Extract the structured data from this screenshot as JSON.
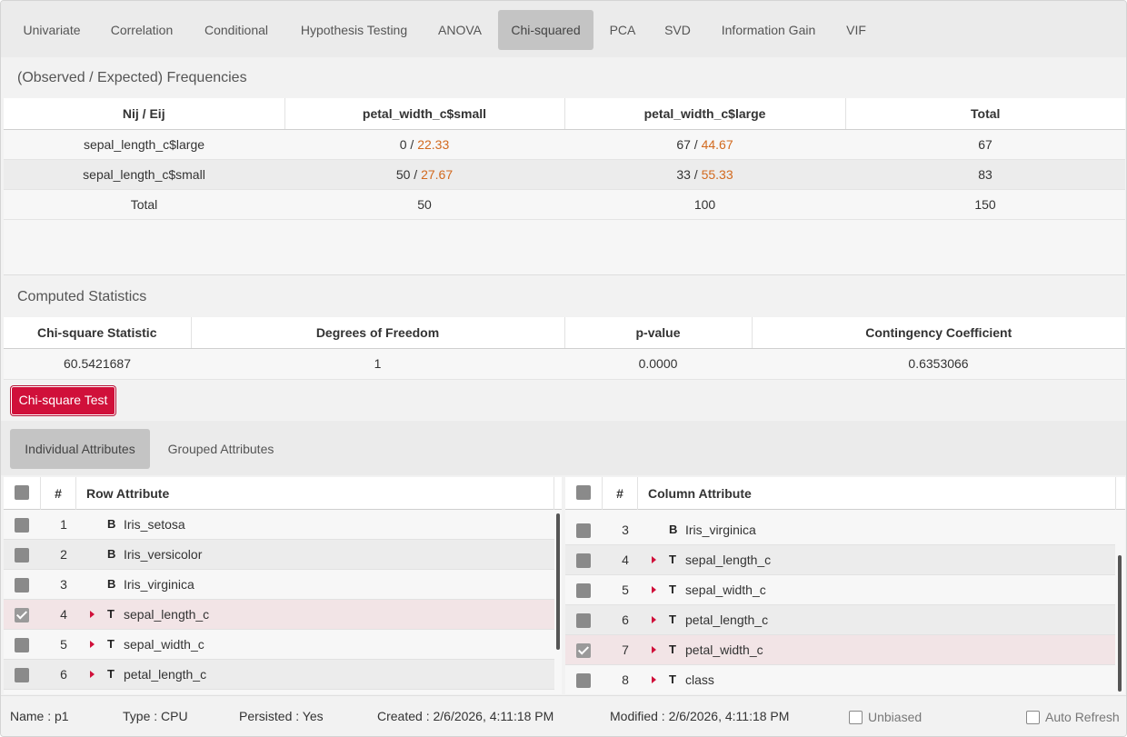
{
  "tabs": [
    {
      "label": "Univariate",
      "active": false
    },
    {
      "label": "Correlation",
      "active": false
    },
    {
      "label": "Conditional",
      "active": false
    },
    {
      "label": "Hypothesis Testing",
      "active": false
    },
    {
      "label": "ANOVA",
      "active": false
    },
    {
      "label": "Chi-squared",
      "active": true
    },
    {
      "label": "PCA",
      "active": false
    },
    {
      "label": "SVD",
      "active": false
    },
    {
      "label": "Information Gain",
      "active": false
    },
    {
      "label": "VIF",
      "active": false
    }
  ],
  "frequencies": {
    "title": "(Observed / Expected) Frequencies",
    "headers": [
      "Nij / Eij",
      "petal_width_c$small",
      "petal_width_c$large",
      "Total"
    ],
    "rows": [
      {
        "label": "sepal_length_c$large",
        "c1_obs": "0",
        "c1_exp": "22.33",
        "c2_obs": "67",
        "c2_exp": "44.67",
        "total": "67"
      },
      {
        "label": "sepal_length_c$small",
        "c1_obs": "50",
        "c1_exp": "27.67",
        "c2_obs": "33",
        "c2_exp": "55.33",
        "total": "83"
      }
    ],
    "totals": {
      "label": "Total",
      "c1": "50",
      "c2": "100",
      "total": "150"
    },
    "separator": " / "
  },
  "stats": {
    "title": "Computed Statistics",
    "headers": [
      "Chi-square Statistic",
      "Degrees of Freedom",
      "p-value",
      "Contingency Coefficient"
    ],
    "values": [
      "60.5421687",
      "1",
      "0.0000",
      "0.6353066"
    ]
  },
  "test_button": "Chi-square Test",
  "subtabs": [
    {
      "label": "Individual Attributes",
      "active": true
    },
    {
      "label": "Grouped Attributes",
      "active": false
    }
  ],
  "row_list": {
    "header_num": "#",
    "header_label": "Row Attribute",
    "items": [
      {
        "num": "1",
        "type": "B",
        "name": "Iris_setosa",
        "checked": false,
        "expandable": false
      },
      {
        "num": "2",
        "type": "B",
        "name": "Iris_versicolor",
        "checked": false,
        "expandable": false
      },
      {
        "num": "3",
        "type": "B",
        "name": "Iris_virginica",
        "checked": false,
        "expandable": false
      },
      {
        "num": "4",
        "type": "T",
        "name": "sepal_length_c",
        "checked": true,
        "expandable": true
      },
      {
        "num": "5",
        "type": "T",
        "name": "sepal_width_c",
        "checked": false,
        "expandable": true
      },
      {
        "num": "6",
        "type": "T",
        "name": "petal_length_c",
        "checked": false,
        "expandable": true
      }
    ]
  },
  "col_list": {
    "header_num": "#",
    "header_label": "Column Attribute",
    "items": [
      {
        "num": "3",
        "type": "B",
        "name": "Iris_virginica",
        "checked": false,
        "expandable": false
      },
      {
        "num": "4",
        "type": "T",
        "name": "sepal_length_c",
        "checked": false,
        "expandable": true
      },
      {
        "num": "5",
        "type": "T",
        "name": "sepal_width_c",
        "checked": false,
        "expandable": true
      },
      {
        "num": "6",
        "type": "T",
        "name": "petal_length_c",
        "checked": false,
        "expandable": true
      },
      {
        "num": "7",
        "type": "T",
        "name": "petal_width_c",
        "checked": true,
        "expandable": true
      },
      {
        "num": "8",
        "type": "T",
        "name": "class",
        "checked": false,
        "expandable": true
      }
    ]
  },
  "status": {
    "name": "Name : p1",
    "type": "Type : CPU",
    "persisted": "Persisted : Yes",
    "created": "Created : 2/6/2026, 4:11:18 PM",
    "modified": "Modified : 2/6/2026, 4:11:18 PM",
    "unbiased_label": "Unbiased",
    "auto_refresh_label": "Auto Refresh"
  },
  "colors": {
    "accent": "#d0103a",
    "expected": "#d2691e",
    "selected_row": "#f2e4e6"
  }
}
